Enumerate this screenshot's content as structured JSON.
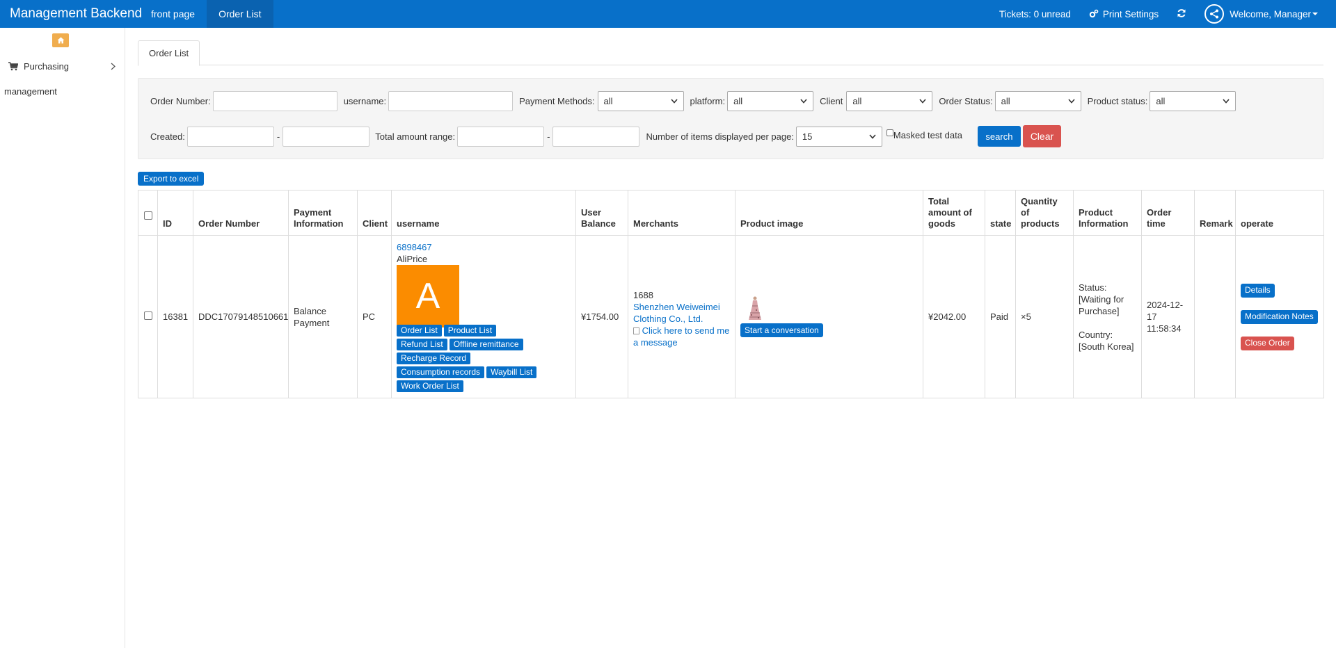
{
  "topbar": {
    "brand": "Management Backend",
    "nav": [
      "front page",
      "Order List"
    ],
    "tickets": "Tickets: 0 unread",
    "print_settings": "Print Settings",
    "welcome": "Welcome, Manager"
  },
  "sidebar": {
    "menu_item": "Purchasing",
    "sub_item": "management"
  },
  "tabs": [
    "Order List"
  ],
  "filters": {
    "order_number_label": "Order Number:",
    "username_label": "username:",
    "payment_methods_label": "Payment Methods:",
    "payment_methods_value": "all",
    "platform_label": "platform:",
    "platform_value": "all",
    "client_label": "Client",
    "client_value": "all",
    "order_status_label": "Order Status:",
    "order_status_value": "all",
    "product_status_label": "Product status:",
    "product_status_value": "all",
    "created_label": "Created:",
    "dash": "-",
    "total_amount_label": "Total amount range:",
    "per_page_label": "Number of items displayed per page:",
    "per_page_value": "15",
    "masked_label": "Masked test data",
    "search_button": "search",
    "clear_button": "Clear"
  },
  "export_button": "Export to excel",
  "table": {
    "headers": [
      "ID",
      "Order Number",
      "Payment Information",
      "Client",
      "username",
      "User Balance",
      "Merchants",
      "Product image",
      "Total amount of goods",
      "state",
      "Quantity of products",
      "Product Information",
      "Order time",
      "Remark",
      "operate"
    ],
    "row": {
      "id": "16381",
      "order_number": "DDC17079148510661",
      "payment_info": "Balance Payment",
      "client": "PC",
      "user_id": "6898467",
      "user_name": "AliPrice",
      "avatar_letter": "A",
      "user_buttons": [
        "Order List",
        "Product List",
        "Refund List",
        "Offline remittance",
        "Recharge Record",
        "Consumption records",
        "Waybill List",
        "Work Order List"
      ],
      "user_balance": "¥1754.00",
      "merchant_platform": "1688",
      "merchant_name": "Shenzhen Weiweimei Clothing Co., Ltd.",
      "merchant_message": "Click here to send me a message",
      "conversation_button": "Start a conversation",
      "total_amount": "¥2042.00",
      "state": "Paid",
      "quantity": "×5",
      "product_status": "Status: [Waiting for Purchase]",
      "product_country": "Country: [South Korea]",
      "order_time": "2024-12-17 11:58:34",
      "remark": "",
      "operate_buttons": [
        "Details",
        "Modification Notes",
        "Close Order"
      ]
    }
  },
  "colors": {
    "primary": "#0870c9",
    "danger": "#d9534f",
    "warning": "#f0ad4e",
    "avatar": "#fb8c00",
    "price": "#e4393c"
  }
}
